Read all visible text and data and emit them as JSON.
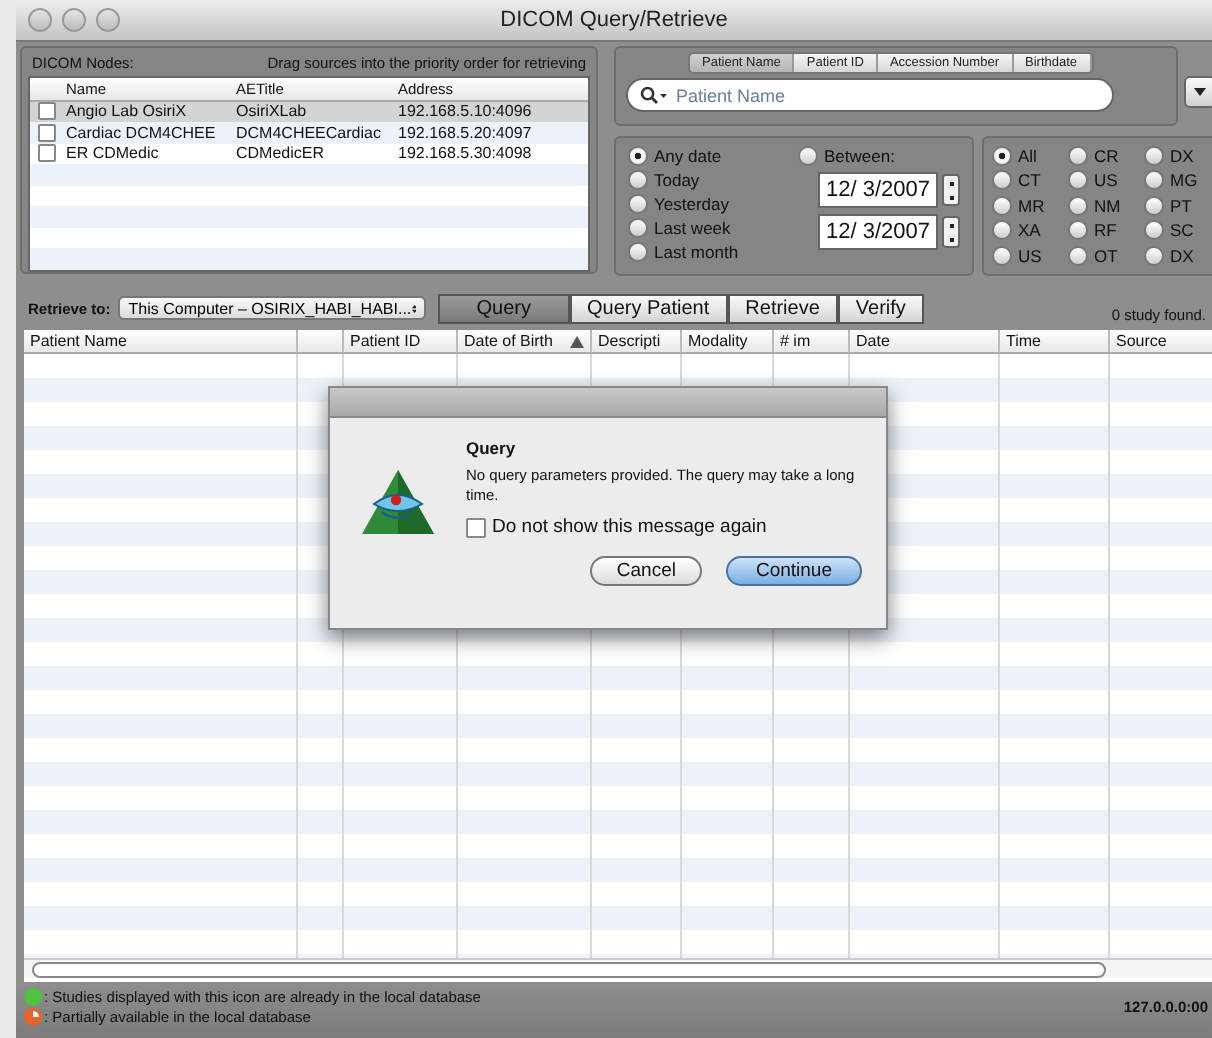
{
  "window": {
    "title": "DICOM Query/Retrieve"
  },
  "nodes": {
    "label": "DICOM Nodes:",
    "hint": "Drag sources into the priority order for retrieving",
    "columns": [
      "Name",
      "AETitle",
      "Address"
    ],
    "rows": [
      {
        "name": "Angio Lab OsiriX",
        "aetitle": "OsiriXLab",
        "address": "192.168.5.10:4096",
        "checked": false,
        "selected": true
      },
      {
        "name": "Cardiac DCM4CHEE",
        "aetitle": "DCM4CHEECardiac",
        "address": "192.168.5.20:4097",
        "checked": false,
        "selected": false
      },
      {
        "name": "ER CDMedic",
        "aetitle": "CDMedicER",
        "address": "192.168.5.30:4098",
        "checked": false,
        "selected": false
      }
    ]
  },
  "search": {
    "tabs": [
      {
        "label": "Patient Name",
        "selected": true
      },
      {
        "label": "Patient ID",
        "selected": false
      },
      {
        "label": "Accession Number",
        "selected": false
      },
      {
        "label": "Birthdate",
        "selected": false
      }
    ],
    "placeholder": "Patient Name"
  },
  "date_filter": {
    "options": [
      {
        "label": "Any date",
        "selected": true
      },
      {
        "label": "Today",
        "selected": false
      },
      {
        "label": "Yesterday",
        "selected": false
      },
      {
        "label": "Last week",
        "selected": false
      },
      {
        "label": "Last month",
        "selected": false
      }
    ],
    "between": {
      "label": "Between:",
      "selected": false
    },
    "dates": [
      "12/ 3/2007",
      "12/ 3/2007"
    ]
  },
  "modalities": [
    {
      "label": "All",
      "selected": true
    },
    {
      "label": "CR",
      "selected": false
    },
    {
      "label": "DX",
      "selected": false
    },
    {
      "label": "CT",
      "selected": false
    },
    {
      "label": "US",
      "selected": false
    },
    {
      "label": "MG",
      "selected": false
    },
    {
      "label": "MR",
      "selected": false
    },
    {
      "label": "NM",
      "selected": false
    },
    {
      "label": "PT",
      "selected": false
    },
    {
      "label": "XA",
      "selected": false
    },
    {
      "label": "RF",
      "selected": false
    },
    {
      "label": "SC",
      "selected": false
    },
    {
      "label": "US",
      "selected": false
    },
    {
      "label": "OT",
      "selected": false
    },
    {
      "label": "DX",
      "selected": false
    }
  ],
  "retrieve": {
    "label": "Retrieve to:",
    "destination": "This Computer – OSIRIX_HABI_HABI..."
  },
  "actions": [
    {
      "label": "Query",
      "selected": true
    },
    {
      "label": "Query Patient",
      "selected": false
    },
    {
      "label": "Retrieve",
      "selected": false
    },
    {
      "label": "Verify",
      "selected": false
    }
  ],
  "status": "0 study found.",
  "table": {
    "columns": [
      {
        "label": "Patient Name",
        "sorted": false
      },
      {
        "label": "Patient ID",
        "sorted": false
      },
      {
        "label": "Date of Birth",
        "sorted": true
      },
      {
        "label": "Descripti",
        "sorted": false
      },
      {
        "label": "Modality",
        "sorted": false
      },
      {
        "label": "# im",
        "sorted": false
      },
      {
        "label": "Date",
        "sorted": false
      },
      {
        "label": "Time",
        "sorted": false
      },
      {
        "label": "Source",
        "sorted": false
      }
    ]
  },
  "legend": [
    {
      "kind": "local",
      "text": ": Studies displayed with this icon are already in the local database"
    },
    {
      "kind": "partial",
      "text": ": Partially available in the local database"
    }
  ],
  "server": "127.0.0.0:00",
  "dialog": {
    "title": "Query",
    "message": "No query parameters provided. The query may take a long time.",
    "checkbox": {
      "label": "Do not show this message again",
      "checked": false
    },
    "buttons": [
      {
        "label": "Cancel",
        "default": false
      },
      {
        "label": "Continue",
        "default": true
      }
    ]
  }
}
